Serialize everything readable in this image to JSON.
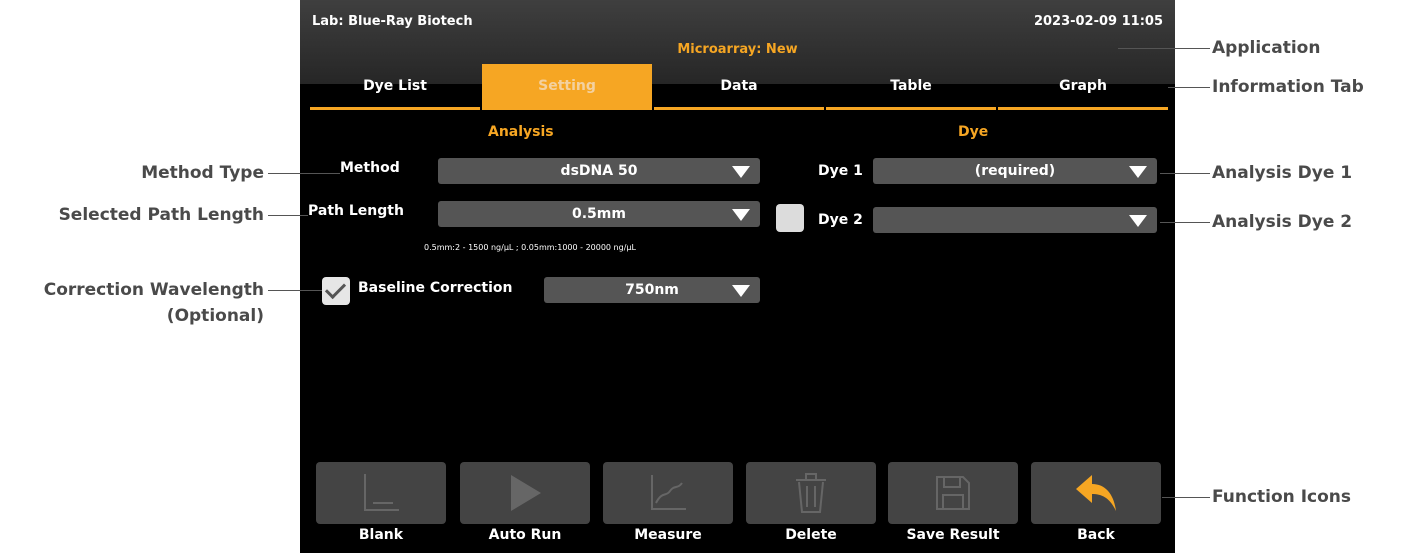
{
  "header": {
    "lab": "Lab: Blue-Ray Biotech",
    "datetime": "2023-02-09 11:05",
    "application": "Microarray: New"
  },
  "tabs": [
    {
      "label": "Dye List",
      "active": false
    },
    {
      "label": "Setting",
      "active": true
    },
    {
      "label": "Data",
      "active": false
    },
    {
      "label": "Table",
      "active": false
    },
    {
      "label": "Graph",
      "active": false
    }
  ],
  "analysis": {
    "title": "Analysis",
    "method_label": "Method",
    "method_value": "dsDNA 50",
    "path_label": "Path Length",
    "path_value": "0.5mm",
    "range_note": "0.5mm:2 - 1500 ng/µL ; 0.05mm:1000 - 20000 ng/µL",
    "baseline_label": "Baseline Correction",
    "baseline_checked": true,
    "baseline_value": "750nm"
  },
  "dye": {
    "title": "Dye",
    "dye1_label": "Dye 1",
    "dye1_value": "(required)",
    "dye2_label": "Dye 2",
    "dye2_value": "",
    "dye2_checked": false
  },
  "functions": [
    {
      "label": "Blank",
      "icon": "blank-icon"
    },
    {
      "label": "Auto Run",
      "icon": "play-icon"
    },
    {
      "label": "Measure",
      "icon": "measure-icon"
    },
    {
      "label": "Delete",
      "icon": "trash-icon"
    },
    {
      "label": "Save Result",
      "icon": "save-icon"
    },
    {
      "label": "Back",
      "icon": "back-arrow-icon"
    }
  ],
  "annotations": {
    "application": "Application",
    "information_tab": "Information Tab",
    "method_type": "Method Type",
    "selected_path_length": "Selected Path Length",
    "correction_wavelength": "Correction Wavelength",
    "optional": "(Optional)",
    "analysis_dye_1": "Analysis Dye 1",
    "analysis_dye_2": "Analysis Dye 2",
    "function_icons": "Function Icons"
  },
  "colors": {
    "accent": "#f6a623",
    "screen_bg": "#000000",
    "control_bg": "#555555"
  }
}
